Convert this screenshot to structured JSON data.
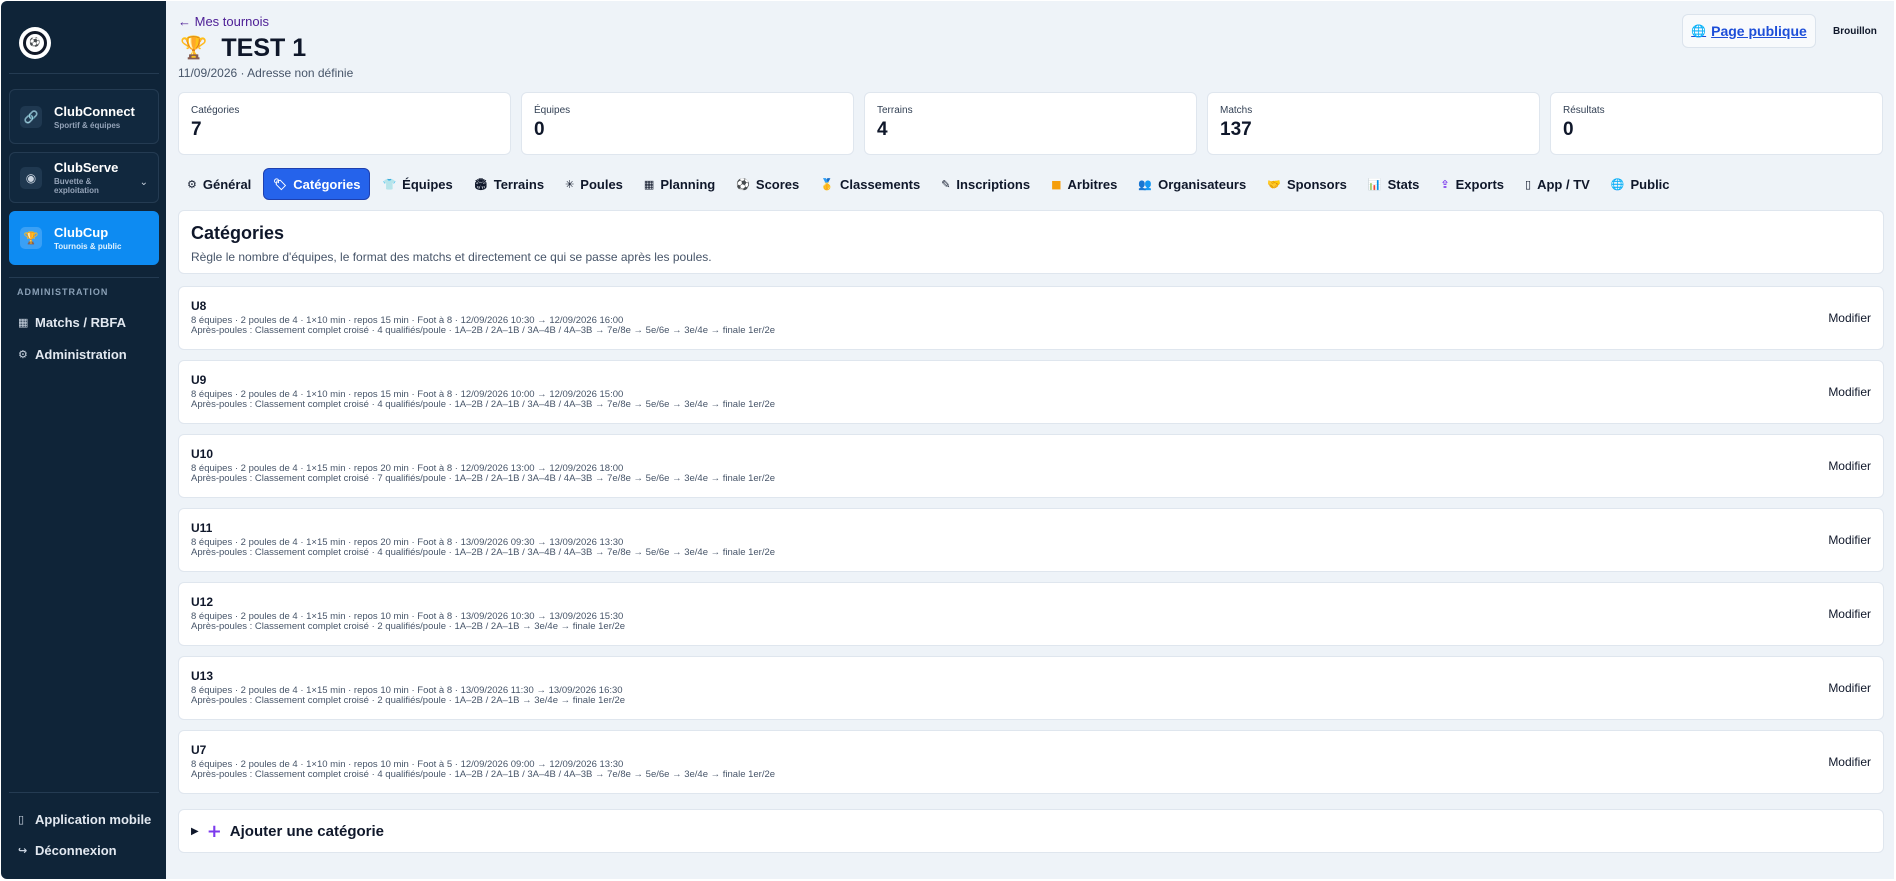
{
  "sidebar": {
    "logo_text": "⚽",
    "apps": [
      {
        "title": "ClubConnect",
        "subtitle": "Sportif & équipes",
        "icon": "link-icon",
        "glyph": "🔗"
      },
      {
        "title": "ClubServe",
        "subtitle": "Buvette & exploitation",
        "icon": "serve-icon",
        "glyph": "◉"
      },
      {
        "title": "ClubCup",
        "subtitle": "Tournois & public",
        "icon": "trophy-icon",
        "glyph": "🏆"
      }
    ],
    "section_label": "ADMINISTRATION",
    "links": [
      {
        "label": "Matchs / RBFA",
        "glyph": "▦"
      },
      {
        "label": "Administration",
        "glyph": "⚙"
      }
    ],
    "bottom_links": [
      {
        "label": "Application mobile",
        "glyph": "▯"
      },
      {
        "label": "Déconnexion",
        "glyph": "↪"
      }
    ]
  },
  "header": {
    "back": "← Mes tournois",
    "trophy": "🏆",
    "title": "TEST 1",
    "subtitle": "11/09/2026 · Adresse non définie",
    "public_page": "Page publique",
    "globe": "🌐",
    "status": "Brouillon"
  },
  "stats": [
    {
      "label": "Catégories",
      "value": "7"
    },
    {
      "label": "Équipes",
      "value": "0"
    },
    {
      "label": "Terrains",
      "value": "4"
    },
    {
      "label": "Matchs",
      "value": "137"
    },
    {
      "label": "Résultats",
      "value": "0"
    }
  ],
  "tabs": [
    {
      "label": "Général",
      "glyph": "⚙"
    },
    {
      "label": "Catégories",
      "glyph": "🏷"
    },
    {
      "label": "Équipes",
      "glyph": "👕"
    },
    {
      "label": "Terrains",
      "glyph": "🏟"
    },
    {
      "label": "Poules",
      "glyph": "✳"
    },
    {
      "label": "Planning",
      "glyph": "▦"
    },
    {
      "label": "Scores",
      "glyph": "⚽"
    },
    {
      "label": "Classements",
      "glyph": "🥇"
    },
    {
      "label": "Inscriptions",
      "glyph": "✎"
    },
    {
      "label": "Arbitres",
      "glyph": "■"
    },
    {
      "label": "Organisateurs",
      "glyph": "👥"
    },
    {
      "label": "Sponsors",
      "glyph": "🤝"
    },
    {
      "label": "Stats",
      "glyph": "📊"
    },
    {
      "label": "Exports",
      "glyph": "⇪"
    },
    {
      "label": "App / TV",
      "glyph": "▯"
    },
    {
      "label": "Public",
      "glyph": "🌐"
    }
  ],
  "active_tab": "Catégories",
  "categories_header": {
    "title": "Catégories",
    "description": "Règle le nombre d'équipes, le format des matchs et directement ce qui se passe après les poules."
  },
  "categories": [
    {
      "name": "U8",
      "line1": "8 équipes · 2 poules de 4 · 1×10 min · repos 15 min · Foot à 8 · 12/09/2026 10:30 → 12/09/2026 16:00",
      "line2": "Après-poules : Classement complet croisé · 4 qualifiés/poule · 1A–2B / 2A–1B / 3A–4B / 4A–3B → 7e/8e → 5e/6e → 3e/4e → finale 1er/2e",
      "action": "Modifier"
    },
    {
      "name": "U9",
      "line1": "8 équipes · 2 poules de 4 · 1×10 min · repos 15 min · Foot à 8 · 12/09/2026 10:00 → 12/09/2026 15:00",
      "line2": "Après-poules : Classement complet croisé · 4 qualifiés/poule · 1A–2B / 2A–1B / 3A–4B / 4A–3B → 7e/8e → 5e/6e → 3e/4e → finale 1er/2e",
      "action": "Modifier"
    },
    {
      "name": "U10",
      "line1": "8 équipes · 2 poules de 4 · 1×15 min · repos 20 min · Foot à 8 · 12/09/2026 13:00 → 12/09/2026 18:00",
      "line2": "Après-poules : Classement complet croisé · 7 qualifiés/poule · 1A–2B / 2A–1B / 3A–4B / 4A–3B → 7e/8e → 5e/6e → 3e/4e → finale 1er/2e",
      "action": "Modifier"
    },
    {
      "name": "U11",
      "line1": "8 équipes · 2 poules de 4 · 1×15 min · repos 20 min · Foot à 8 · 13/09/2026 09:30 → 13/09/2026 13:30",
      "line2": "Après-poules : Classement complet croisé · 4 qualifiés/poule · 1A–2B / 2A–1B / 3A–4B / 4A–3B → 7e/8e → 5e/6e → 3e/4e → finale 1er/2e",
      "action": "Modifier"
    },
    {
      "name": "U12",
      "line1": "8 équipes · 2 poules de 4 · 1×15 min · repos 10 min · Foot à 8 · 13/09/2026 10:30 → 13/09/2026 15:30",
      "line2": "Après-poules : Classement complet croisé · 2 qualifiés/poule · 1A–2B / 2A–1B → 3e/4e → finale 1er/2e",
      "action": "Modifier"
    },
    {
      "name": "U13",
      "line1": "8 équipes · 2 poules de 4 · 1×15 min · repos 10 min · Foot à 8 · 13/09/2026 11:30 → 13/09/2026 16:30",
      "line2": "Après-poules : Classement complet croisé · 2 qualifiés/poule · 1A–2B / 2A–1B → 3e/4e → finale 1er/2e",
      "action": "Modifier"
    },
    {
      "name": "U7",
      "line1": "8 équipes · 2 poules de 4 · 1×10 min · repos 10 min · Foot à 5 · 12/09/2026 09:00 → 12/09/2026 13:30",
      "line2": "Après-poules : Classement complet croisé · 4 qualifiés/poule · 1A–2B / 2A–1B / 3A–4B / 4A–3B → 7e/8e → 5e/6e → 3e/4e → finale 1er/2e",
      "action": "Modifier"
    }
  ],
  "add_category": {
    "triangle": "▶",
    "plus": "+",
    "label": "Ajouter une catégorie"
  }
}
